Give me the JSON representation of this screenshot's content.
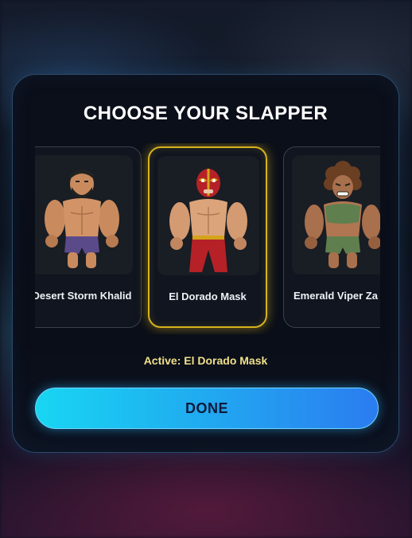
{
  "modal": {
    "title": "CHOOSE YOUR SLAPPER",
    "active_label": "Active: El Dorado Mask",
    "done_label": "DONE"
  },
  "slappers": [
    {
      "name": "Desert Storm Khalid",
      "selected": false
    },
    {
      "name": "El Dorado Mask",
      "selected": true
    },
    {
      "name": "Emerald Viper Za",
      "selected": false
    }
  ],
  "colors": {
    "selected_border": "#d6b21e",
    "active_text": "#f0e08a",
    "done_gradient_start": "#18d6f2",
    "done_gradient_end": "#2b7cf0"
  }
}
